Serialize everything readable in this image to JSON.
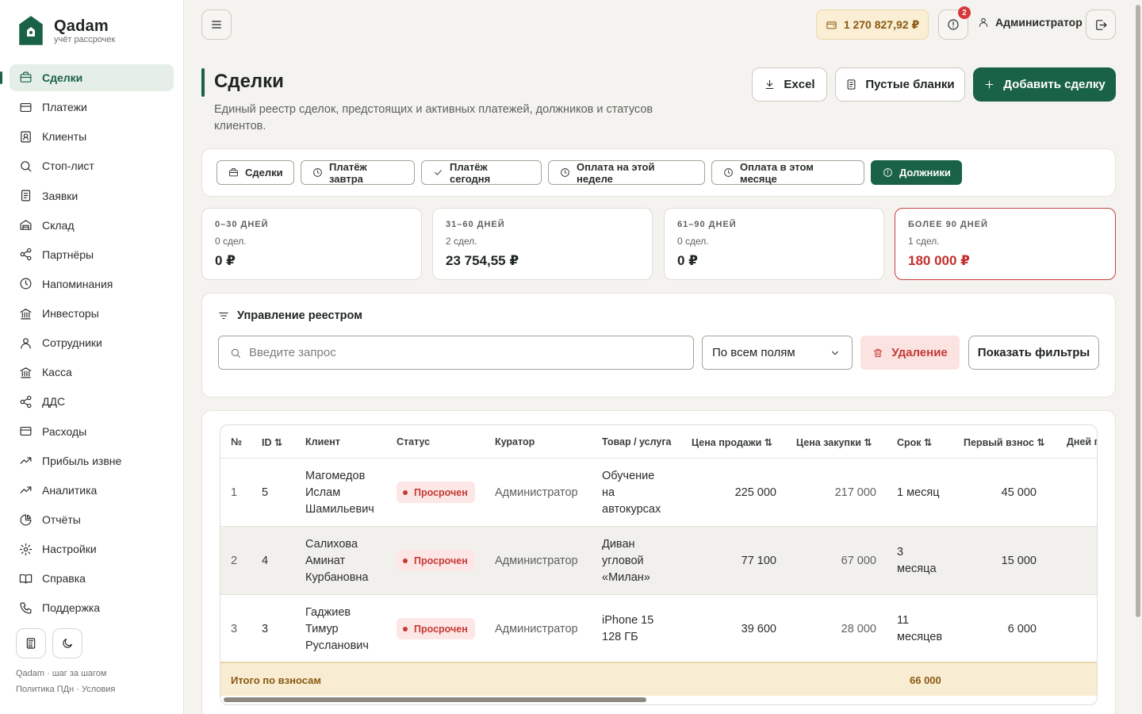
{
  "app": {
    "name": "Qadam",
    "subtitle": "учёт рассрочек"
  },
  "sidebar": {
    "items": [
      {
        "label": "Сделки",
        "icon": "briefcase-icon",
        "active": true
      },
      {
        "label": "Платежи",
        "icon": "card-icon"
      },
      {
        "label": "Клиенты",
        "icon": "contact-icon"
      },
      {
        "label": "Стоп-лист",
        "icon": "search-icon"
      },
      {
        "label": "Заявки",
        "icon": "document-icon"
      },
      {
        "label": "Склад",
        "icon": "warehouse-icon"
      },
      {
        "label": "Партнёры",
        "icon": "share-icon"
      },
      {
        "label": "Напоминания",
        "icon": "clock-icon"
      },
      {
        "label": "Инвесторы",
        "icon": "bank-icon"
      },
      {
        "label": "Сотрудники",
        "icon": "user-icon"
      },
      {
        "label": "Касса",
        "icon": "bank-icon"
      },
      {
        "label": "ДДС",
        "icon": "share-icon"
      },
      {
        "label": "Расходы",
        "icon": "card-icon"
      },
      {
        "label": "Прибыль извне",
        "icon": "trend-icon"
      },
      {
        "label": "Аналитика",
        "icon": "trend-icon"
      },
      {
        "label": "Отчёты",
        "icon": "pie-icon"
      },
      {
        "label": "Настройки",
        "icon": "gear-icon"
      },
      {
        "label": "Справка",
        "icon": "book-icon"
      },
      {
        "label": "Поддержка",
        "icon": "phone-icon"
      }
    ],
    "footer_line1": "Qadam · шаг за шагом",
    "footer_line2": "Политика ПДн · Условия"
  },
  "topbar": {
    "balance": "1 270 827,92 ₽",
    "notifications_count": "2",
    "user": "Администратор"
  },
  "header": {
    "title": "Сделки",
    "description": "Единый реестр сделок, предстоящих и активных платежей, должников и статусов клиентов.",
    "excel_label": "Excel",
    "blanks_label": "Пустые бланки",
    "add_label": "Добавить сделку"
  },
  "quick_filters": [
    {
      "label": "Сделки",
      "icon": "briefcase-icon"
    },
    {
      "label": "Платёж завтра",
      "icon": "clock-icon"
    },
    {
      "label": "Платёж сегодня",
      "icon": "check-icon"
    },
    {
      "label": "Оплата на этой неделе",
      "icon": "clock-icon"
    },
    {
      "label": "Оплата в этом месяце",
      "icon": "clock-icon"
    },
    {
      "label": "Должники",
      "icon": "alert-icon",
      "active": true
    }
  ],
  "aging": [
    {
      "label": "0–30 ДНЕЙ",
      "count": "0 сдел.",
      "sum": "0 ₽"
    },
    {
      "label": "31–60 ДНЕЙ",
      "count": "2 сдел.",
      "sum": "23 754,55 ₽"
    },
    {
      "label": "61–90 ДНЕЙ",
      "count": "0 сдел.",
      "sum": "0 ₽"
    },
    {
      "label": "БОЛЕЕ 90 ДНЕЙ",
      "count": "1 сдел.",
      "sum": "180 000 ₽"
    }
  ],
  "registry": {
    "title": "Управление реестром",
    "search_placeholder": "Введите запрос",
    "field_select": "По всем полям",
    "delete_label": "Удаление",
    "filters_label": "Показать фильтры"
  },
  "table": {
    "headers": [
      "№",
      "ID ⇅",
      "Клиент",
      "Статус",
      "Куратор",
      "Товар / услуга",
      "Цена продажи ⇅",
      "Цена закупки ⇅",
      "Срок ⇅",
      "Первый взнос ⇅",
      "Дней п"
    ],
    "rows": [
      {
        "num": "1",
        "id": "5",
        "client": "Магомедов Ислам Шамильевич",
        "status": "Просрочен",
        "curator": "Администратор",
        "product": "Обучение на автокурсах",
        "sale": "225 000",
        "purchase": "217 000",
        "term": "1 месяц",
        "first": "45 000"
      },
      {
        "num": "2",
        "id": "4",
        "client": "Салихова Аминат Курбановна",
        "status": "Просрочен",
        "curator": "Администратор",
        "product": "Диван угловой «Милан»",
        "sale": "77 100",
        "purchase": "67 000",
        "term": "3 месяца",
        "first": "15 000"
      },
      {
        "num": "3",
        "id": "3",
        "client": "Гаджиев Тимур Русланович",
        "status": "Просрочен",
        "curator": "Администратор",
        "product": "iPhone 15 128 ГБ",
        "sale": "39 600",
        "purchase": "28 000",
        "term": "11 месяцев",
        "first": "6 000"
      }
    ],
    "total_label": "Итого по взносам",
    "total_value": "66 000"
  },
  "colors": {
    "accent": "#1a6246",
    "danger": "#c42d2d",
    "balance_bg": "#faeed5"
  }
}
